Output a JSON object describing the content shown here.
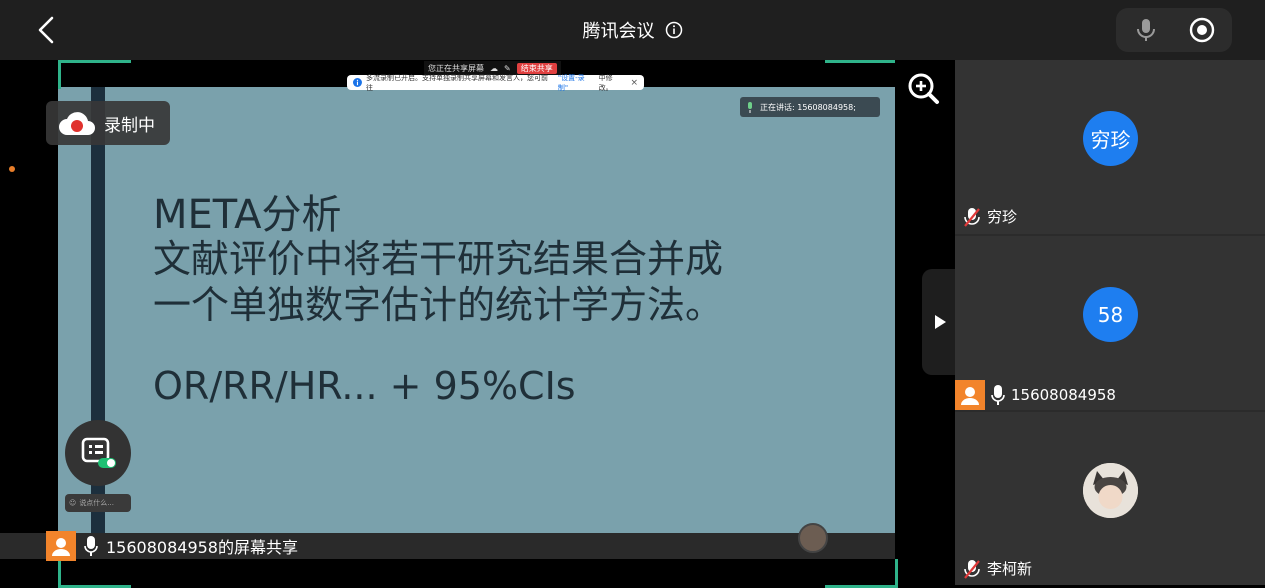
{
  "app": {
    "title": "腾讯会议"
  },
  "icons": {
    "back": "chevron-left-icon",
    "info": "info-icon",
    "mic": "microphone-icon",
    "record": "record-icon",
    "zoom": "zoom-in-icon"
  },
  "colors": {
    "accent_blue": "#1e7ef0",
    "recording_red": "#e0312d",
    "frame_green": "#2fb38a",
    "slide_bg": "#7aa1ac"
  },
  "share": {
    "toolbar_status": "您正在共享屏幕",
    "end_share": "结束共享",
    "notice_text": "多流录制已开启。支持单独录制共享屏幕和发言人，您可前往",
    "notice_link": "\"设置-录制\"",
    "notice_tail": "中修改。",
    "speaking_label": "正在讲话: 15608084958;"
  },
  "slide": {
    "line1": "META分析",
    "line2": "文献评价中将若干研究结果合并成",
    "line3": "一个单独数字估计的统计学方法。",
    "line4": "OR/RR/HR... + 95%CIs"
  },
  "recording": {
    "label": "录制中"
  },
  "chat": {
    "placeholder": "说点什么..."
  },
  "bottom": {
    "sharer_label": "15608084958的屏幕共享"
  },
  "participants": [
    {
      "avatar_text": "穷珍",
      "name": "穷珍",
      "muted": true
    },
    {
      "avatar_text": "58",
      "name": "15608084958",
      "muted": false
    },
    {
      "avatar_text": "",
      "name": "李柯新",
      "muted": true
    }
  ]
}
